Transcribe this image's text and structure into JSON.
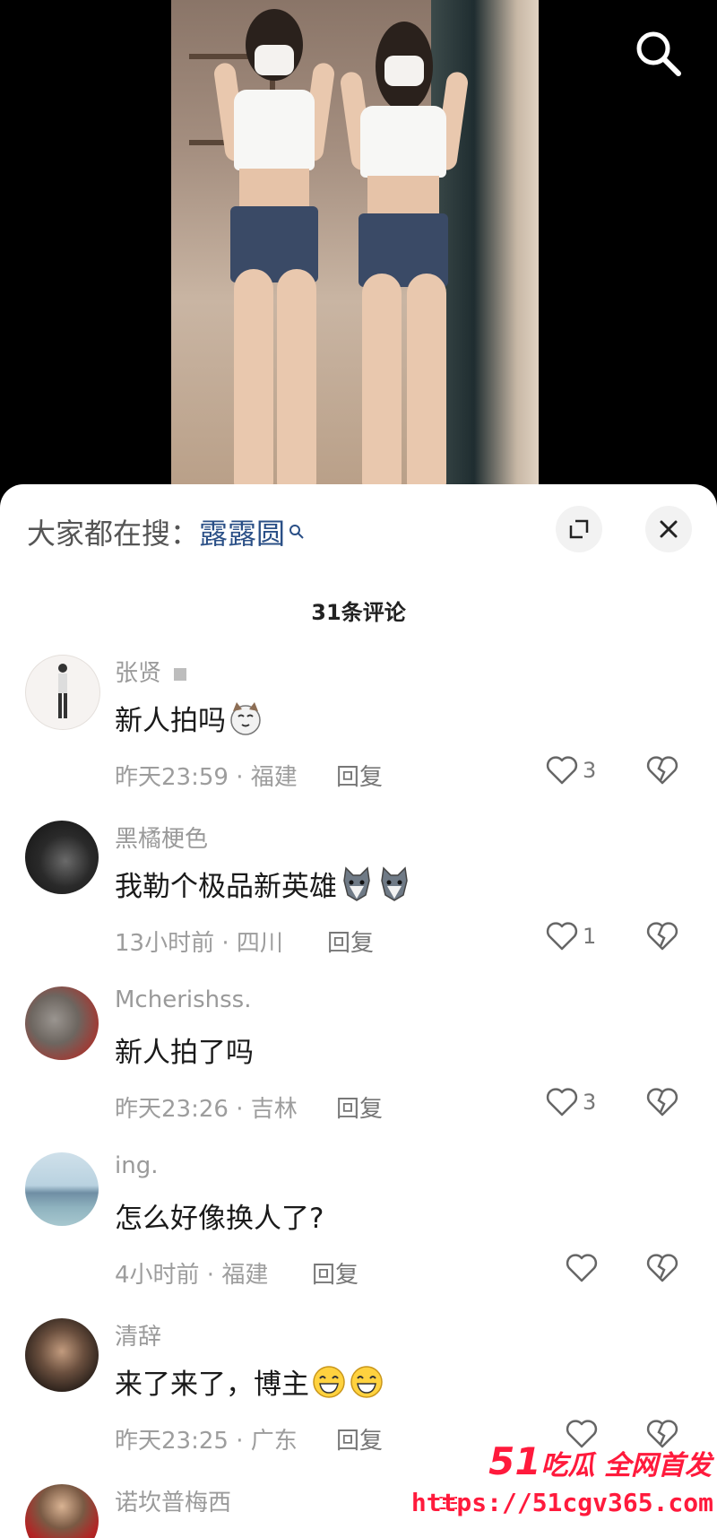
{
  "sheet": {
    "search_prefix": "大家都在搜：",
    "search_term": "露露圆",
    "comment_count_title": "31条评论"
  },
  "comments": [
    {
      "username": "张贤",
      "text": "新人拍吗",
      "emoji": [
        "cat-face-icon"
      ],
      "meta": "昨天23:59 · 福建",
      "reply": "回复",
      "likes": "3"
    },
    {
      "username": "黑橘梗色",
      "text": "我勒个极品新英雄",
      "emoji": [
        "wolf-face-icon",
        "wolf-face-icon"
      ],
      "meta": "13小时前 · 四川",
      "reply": "回复",
      "likes": "1"
    },
    {
      "username": "Mcherishss.",
      "text": "新人拍了吗",
      "emoji": [],
      "meta": "昨天23:26 · 吉林",
      "reply": "回复",
      "likes": "3"
    },
    {
      "username": "ing.",
      "text": "怎么好像换人了?",
      "emoji": [],
      "meta": "4小时前 · 福建",
      "reply": "回复",
      "likes": ""
    },
    {
      "username": "清辞",
      "text": "来了来了，博主",
      "emoji": [
        "grin-face-icon",
        "grin-face-icon"
      ],
      "meta": "昨天23:25 · 广东",
      "reply": "回复",
      "likes": ""
    },
    {
      "username": "诺坎普梅西",
      "text": "",
      "emoji": [],
      "meta": "",
      "reply": "",
      "likes": ""
    }
  ],
  "watermark": {
    "brand_num": "51",
    "brand_text": "吃瓜 全网首发",
    "url": "https://51cgv365.com"
  },
  "colors": {
    "accent_link": "#2a4f86",
    "watermark_red": "#ff1a3c"
  }
}
